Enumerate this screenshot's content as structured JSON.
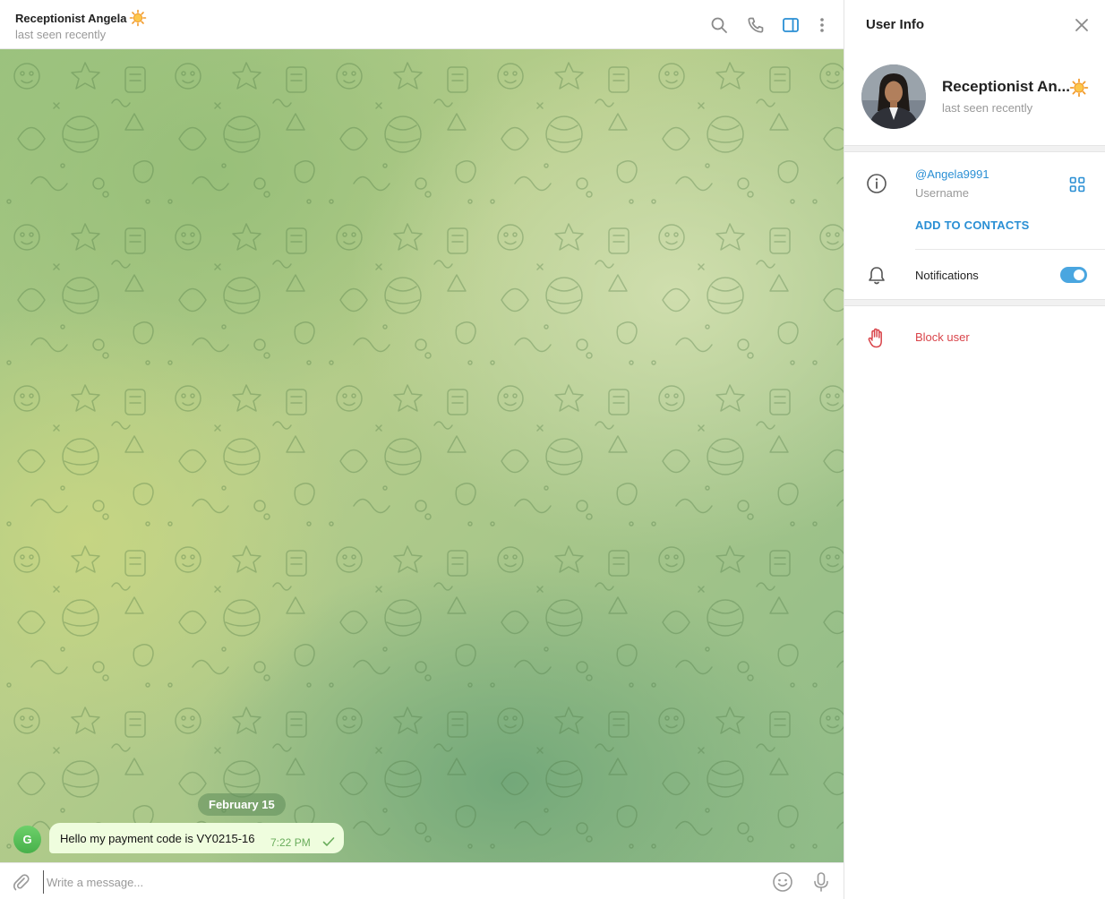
{
  "chat": {
    "title": "Receptionist Angela",
    "status": "last seen recently",
    "date_separator": "February 15",
    "messages": [
      {
        "sender_initial": "G",
        "text": "Hello my payment code is VY0215-16",
        "time": "7:22 PM",
        "status": "sent"
      }
    ],
    "composer": {
      "placeholder": "Write a message..."
    }
  },
  "info_panel": {
    "title": "User Info",
    "profile": {
      "name": "Receptionist An...",
      "status": "last seen recently"
    },
    "username": {
      "value": "@Angela9991",
      "label": "Username"
    },
    "add_contacts": "ADD TO CONTACTS",
    "notifications": {
      "label": "Notifications",
      "enabled": true
    },
    "block": "Block user"
  },
  "icons": [
    "sun-emoji-icon",
    "search-icon",
    "phone-icon",
    "sidebar-toggle-icon",
    "more-vertical-icon",
    "check-icon",
    "paperclip-icon",
    "emoji-icon",
    "microphone-icon",
    "close-icon",
    "info-icon",
    "qr-code-icon",
    "bell-icon",
    "hand-stop-icon"
  ],
  "colors": {
    "accent": "#2a8fd4",
    "bubble": "#effdde",
    "danger": "#d9444a",
    "toggle": "#4aa6e0",
    "wallpaper": "#9cc37f"
  }
}
